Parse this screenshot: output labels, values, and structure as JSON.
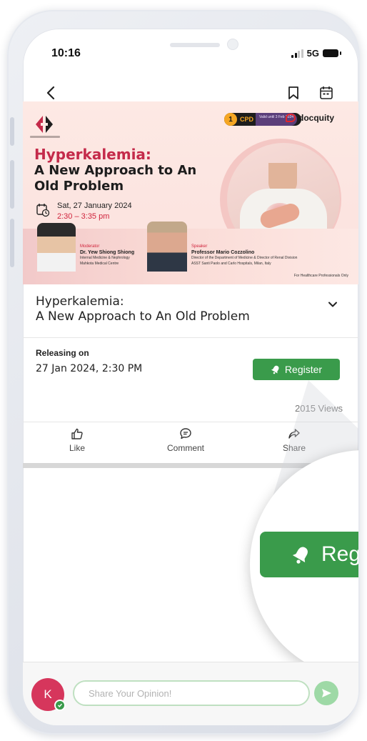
{
  "status_bar": {
    "time": "10:16",
    "network": "5G"
  },
  "banner": {
    "cpd_number": "1",
    "cpd_label": "CPD",
    "cpd_validity": "Valid until 3 Feb 2024",
    "brand": "docquity",
    "title_line1": "Hyperkalemia:",
    "title_line2": "A New Approach to An Old Problem",
    "date": "Sat, 27 January 2024",
    "time": "2:30 – 3:35 pm",
    "moderator": {
      "role": "Moderator",
      "name": "Dr. Yew Shiong Shiong",
      "desc_line1": "Internal Medicine & Nephrology",
      "desc_line2": "Mahkota Medical Centre"
    },
    "speaker": {
      "role": "Speaker",
      "name": "Professor Mario Cozzolino",
      "desc_line1": "Director of the Department of Medicine & Director of Renal Division",
      "desc_line2": "ASST Santi Paolo and Carlo Hospitals, Milan, Italy"
    },
    "footnote": "For Healthcare Professionals Only"
  },
  "content": {
    "title_line1": "Hyperkalemia:",
    "title_line2": "A New Approach to An Old Problem",
    "releasing_label": "Releasing on",
    "release_date": "27 Jan 2024, 2:30 PM",
    "register_label": "Register",
    "views": "2015 Views"
  },
  "actions": {
    "like": "Like",
    "comment": "Comment",
    "share": "Share"
  },
  "zoom": {
    "label": "Reg"
  },
  "comment_bar": {
    "avatar_initial": "K",
    "placeholder": "Share Your Opinion!"
  },
  "colors": {
    "accent_green": "#3a9b4b",
    "title_red": "#c42a4a",
    "avatar_pink": "#d6365c"
  }
}
